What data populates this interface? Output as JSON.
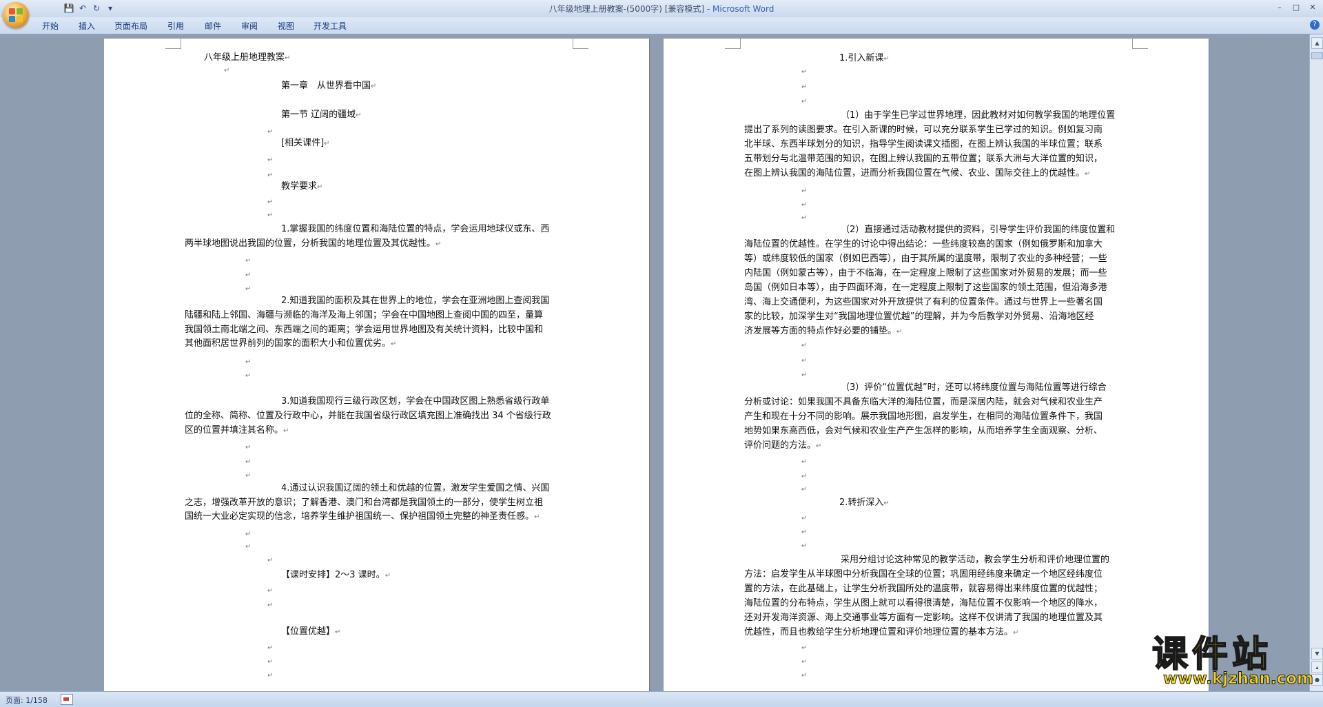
{
  "window": {
    "title": "八年级地理上册教案-(5000字) [兼容模式]",
    "app_name": "Microsoft Word",
    "title_separator": " - "
  },
  "quick_access": {
    "save_icon": "💾",
    "undo_icon": "↶",
    "redo_icon": "↻",
    "more_icon": "▾"
  },
  "window_controls": {
    "minimize": "–",
    "maximize": "□",
    "close": "✕"
  },
  "ribbon": {
    "tabs": [
      "开始",
      "插入",
      "页面布局",
      "引用",
      "邮件",
      "审阅",
      "视图",
      "开发工具"
    ],
    "help_icon": "?"
  },
  "page1": {
    "lines": [
      "八年级上册地理教案",
      "第一章　从世界看中国",
      "第一节 辽阔的疆域",
      "[相关课件]",
      "教学要求",
      "1.掌握我国的纬度位置和海陆位置的特点，学会运用地球仪或东、西",
      "两半球地图说出我国的位置，分析我国的地理位置及其优越性。",
      "2.知道我国的面积及其在世界上的地位，学会在亚洲地图上查阅我国",
      "陆疆和陆上邻国、海疆与濒临的海洋及海上邻国；学会在中国地图上查阅中国的四至，量算",
      "我国领土南北端之间、东西端之间的距离；学会运用世界地图及有关统计资料，比较中国和",
      "其他面积居世界前列的国家的面积大小和位置优劣。",
      "3.知道我国现行三级行政区划，学会在中国政区图上熟悉省级行政单",
      "位的全称、简称、位置及行政中心，并能在我国省级行政区填充图上准确找出 34 个省级行政",
      "区的位置并填注其名称。",
      "4.通过认识我国辽阔的领土和优越的位置，激发学生爱国之情、兴国",
      "之志，增强改革开放的意识；了解香港、澳门和台湾都是我国领土的一部分，使学生树立祖",
      "国统一大业必定实现的信念，培养学生维护祖国统一、保护祖国领土完整的神圣责任感。",
      "【课时安排】2～3 课时。",
      "【位置优越】"
    ]
  },
  "page2": {
    "lines": [
      "1.引入新课",
      "（1）由于学生已学过世界地理，因此教材对如何教学我国的地理位置",
      "提出了系列的读图要求。在引入新课的时候，可以充分联系学生已学过的知识。例如复习南",
      "北半球、东西半球划分的知识，指导学生阅读课文插图，在图上辨认我国的半球位置；联系",
      "五带划分与北温带范围的知识，在图上辨认我国的五带位置；联系大洲与大洋位置的知识，",
      "在图上辨认我国的海陆位置，进而分析我国位置在气候、农业、国际交往上的优越性。",
      "（2）直接通过活动教材提供的资料，引导学生评价我国的纬度位置和",
      "海陆位置的优越性。在学生的讨论中得出结论：一些纬度较高的国家（例如俄罗斯和加拿大",
      "等）或纬度较低的国家（例如巴西等），由于其所属的温度带，限制了农业的多种经营；一些",
      "内陆国（例如蒙古等），由于不临海，在一定程度上限制了这些国家对外贸易的发展；而一些",
      "岛国（例如日本等），由于四面环海，在一定程度上限制了这些国家的领土范围，但沿海多港",
      "湾、海上交通便利，为这些国家对外开放提供了有利的位置条件。通过与世界上一些著名国",
      "家的比较，加深学生对“我国地理位置优越”的理解，并为今后教学对外贸易、沿海地区经",
      "济发展等方面的特点作好必要的铺垫。",
      "（3）评价“位置优越”时，还可以将纬度位置与海陆位置等进行综合",
      "分析或讨论：如果我国不具备东临大洋的海陆位置，而是深居内陆，就会对气候和农业生产",
      "产生和现在十分不同的影响。展示我国地形图，启发学生，在相同的海陆位置条件下，我国",
      "地势如果东高西低，会对气候和农业生产产生怎样的影响，从而培养学生全面观察、分析、",
      "评价问题的方法。",
      "2.转折深入",
      "采用分组讨论这种常见的教学活动，教会学生分析和评价地理位置的",
      "方法：启发学生从半球图中分析我国在全球的位置；巩固用经纬度来确定一个地区经纬度位",
      "置的方法，在此基础上，让学生分析我国所处的温度带，就容易得出来纬度位置的优越性；",
      "海陆位置的分布特点，学生从图上就可以看得很清楚，海陆位置不仅影响一个地区的降水，",
      "还对开发海洋资源、海上交通事业等方面有一定影响。这样不仅讲清了我国的地理位置及其",
      "优越性，而且也教给学生分析地理位置和评价地理位置的基本方法。"
    ]
  },
  "paragraph_mark": "↵",
  "status": {
    "page_indicator": "页面: 1/158"
  },
  "watermark": {
    "text": "课件站",
    "url": "www.kjzhan.com"
  },
  "colors": {
    "accent": "#2d63b6",
    "watermark": "#f3d51a"
  }
}
